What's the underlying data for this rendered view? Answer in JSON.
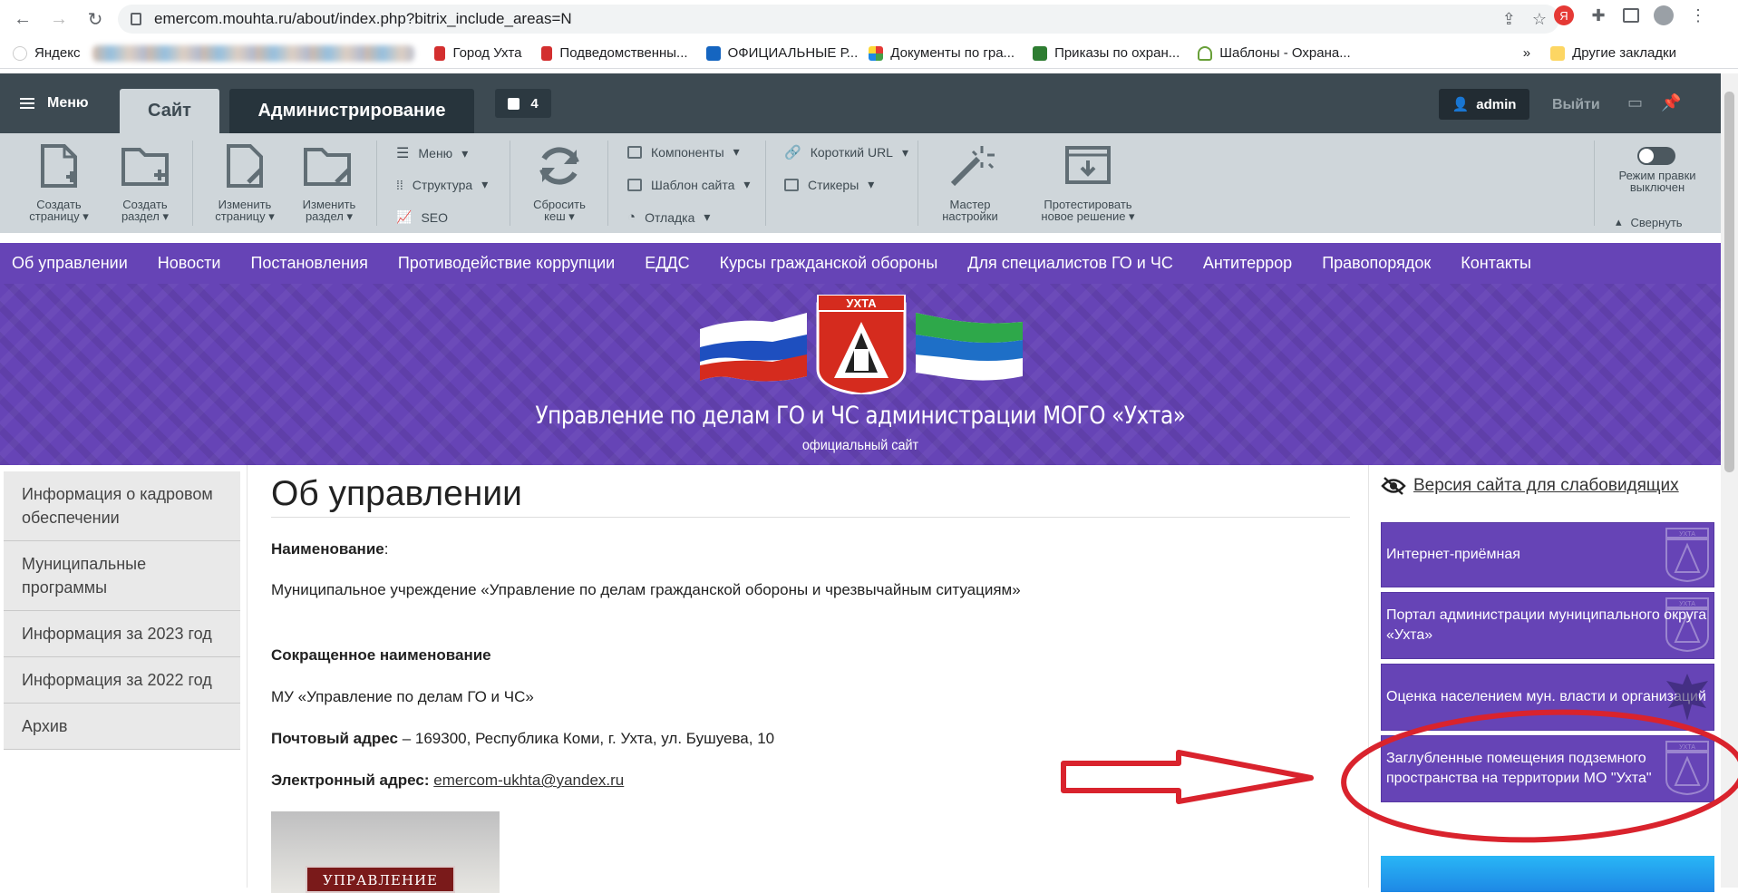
{
  "browser": {
    "url": "emercom.mouhta.ru/about/index.php?bitrix_include_areas=N",
    "bookmarks": [
      "Яндекс",
      "Город Ухта",
      "Подведомственны...",
      "ОФИЦИАЛЬНЫЕ Р...",
      "Документы по гра...",
      "Приказы по охран...",
      "Шаблоны - Охрана...",
      "»",
      "Другие закладки"
    ]
  },
  "admin_panel": {
    "menu_label": "Меню",
    "tab_site": "Сайт",
    "tab_admin": "Администрирование",
    "notif_count": "4",
    "user": "admin",
    "logout": "Выйти",
    "tools": {
      "create_page": [
        "Создать",
        "страницу"
      ],
      "create_section": [
        "Создать",
        "раздел"
      ],
      "edit_page": [
        "Изменить",
        "страницу"
      ],
      "edit_section": [
        "Изменить",
        "раздел"
      ],
      "menu": "Меню",
      "structure": "Структура",
      "seo": "SEO",
      "reset_cache": [
        "Сбросить",
        "кеш"
      ],
      "components": "Компоненты",
      "site_template": "Шаблон сайта",
      "debug": "Отладка",
      "short_url": "Короткий URL",
      "stickers": "Стикеры",
      "wizard": [
        "Мастер",
        "настройки"
      ],
      "test_solution": [
        "Протестировать",
        "новое решение"
      ],
      "edit_mode": [
        "Режим правки",
        "выключен"
      ],
      "collapse": "Свернуть"
    }
  },
  "site_nav": [
    "Об управлении",
    "Новости",
    "Постановления",
    "Противодействие коррупции",
    "ЕДДС",
    "Курсы гражданской обороны",
    "Для специалистов ГО и ЧС",
    "Антитеррор",
    "Правопорядок",
    "Контакты"
  ],
  "banner": {
    "emblem_text": "УХТА",
    "title": "Управление по делам ГО и ЧС администрации МОГО «Ухта»",
    "subtitle": "официальный сайт"
  },
  "sidebar": [
    "Информация о кадровом обеспечении",
    "Муниципальные программы",
    "Информация за 2023 год",
    "Информация за 2022 год",
    "Архив"
  ],
  "main": {
    "heading": "Об управлении",
    "name_label": "Наименование",
    "name_colon": ":",
    "name_value": "Муниципальное учреждение «Управление по делам гражданской обороны и чрезвычайным ситуациям»",
    "short_name_label": "Сокращенное наименование",
    "short_name_value": "МУ «Управление по делам ГО и ЧС»",
    "postal_label": "Почтовый адрес",
    "postal_value": " – 169300, Республика Коми, г. Ухта, ул. Бушуева, 10",
    "email_label": "Электронный адрес:",
    "email_value": "emercom-ukhta@yandex.ru",
    "photo_sign": "УПРАВЛЕНИЕ"
  },
  "right": {
    "vi_link": "Версия сайта для слабовидящих",
    "cards": [
      "Интернет-приёмная",
      "Портал администрации муниципального округа «Ухта»",
      "Оценка населением мун. власти и организаций",
      "Заглубленные помещения подземного пространства на территории МО \"Ухта\""
    ],
    "card_logo_text": "УХТА"
  },
  "annotation": {
    "color": "#d9232d"
  }
}
